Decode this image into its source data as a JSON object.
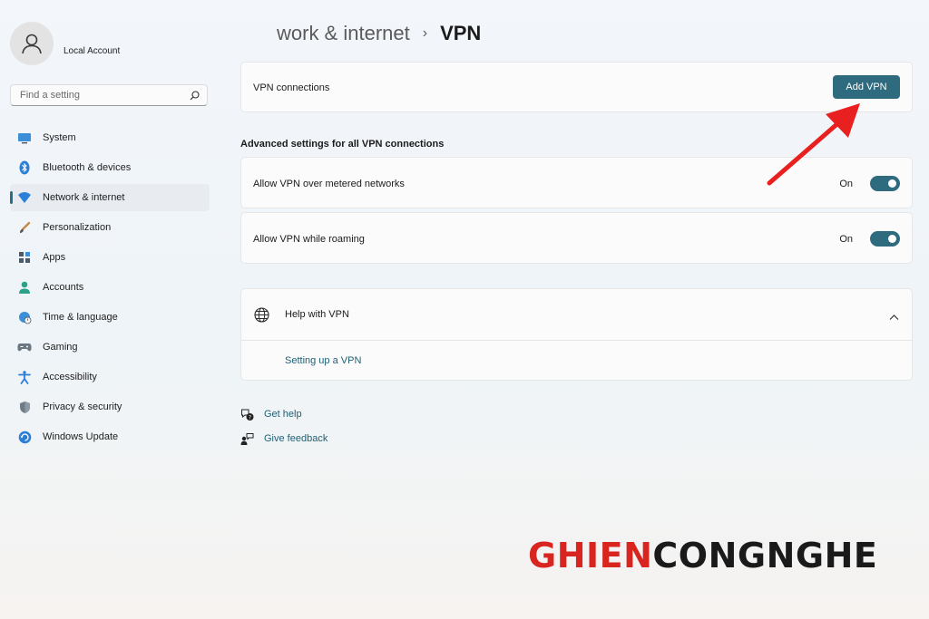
{
  "account": {
    "name": "Local Account"
  },
  "search": {
    "placeholder": "Find a setting"
  },
  "sidebar": {
    "items": [
      {
        "label": "System",
        "icon": "display-icon"
      },
      {
        "label": "Bluetooth & devices",
        "icon": "bluetooth-icon"
      },
      {
        "label": "Network & internet",
        "icon": "wifi-icon",
        "selected": true
      },
      {
        "label": "Personalization",
        "icon": "brush-icon"
      },
      {
        "label": "Apps",
        "icon": "apps-icon"
      },
      {
        "label": "Accounts",
        "icon": "person-icon"
      },
      {
        "label": "Time & language",
        "icon": "globe-clock-icon"
      },
      {
        "label": "Gaming",
        "icon": "gamepad-icon"
      },
      {
        "label": "Accessibility",
        "icon": "accessibility-icon"
      },
      {
        "label": "Privacy & security",
        "icon": "shield-icon"
      },
      {
        "label": "Windows Update",
        "icon": "update-icon"
      }
    ]
  },
  "header": {
    "parent": "work & internet",
    "separator": "›",
    "current": "VPN"
  },
  "vpn": {
    "connections_label": "VPN connections",
    "add_button": "Add VPN"
  },
  "advanced": {
    "title": "Advanced settings for all VPN connections",
    "metered": {
      "label": "Allow VPN over metered networks",
      "state": "On"
    },
    "roaming": {
      "label": "Allow VPN while roaming",
      "state": "On"
    }
  },
  "help": {
    "title": "Help with VPN",
    "link": "Setting up a VPN"
  },
  "footer": {
    "get_help": "Get help",
    "give_feedback": "Give feedback"
  },
  "watermark": {
    "part1": "GHIEN",
    "part2": "CONGNGHE"
  },
  "colors": {
    "accent": "#2f6b7e",
    "link": "#1f5f74",
    "arrow": "#e8201f",
    "watermark_red": "#d8251f",
    "watermark_dark": "#1a1a1a"
  }
}
